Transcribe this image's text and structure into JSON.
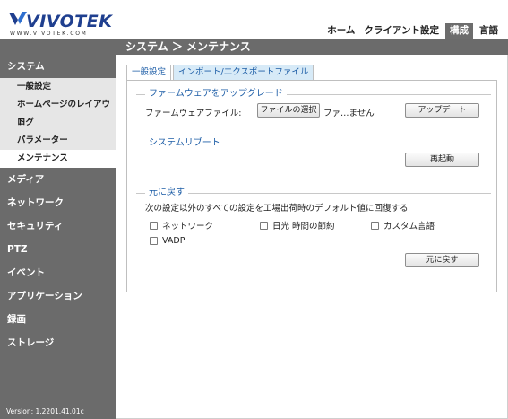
{
  "brand": {
    "name": "VIVOTEK",
    "url": "WWW.VIVOTEK.COM"
  },
  "topnav": [
    {
      "label": "ホーム",
      "active": false
    },
    {
      "label": "クライアント設定",
      "active": false
    },
    {
      "label": "構成",
      "active": true
    },
    {
      "label": "言語",
      "active": false
    }
  ],
  "page_title": "システム ＞ メンテナンス",
  "sidebar": {
    "system": {
      "label": "システム",
      "items": [
        {
          "label": "一般設定",
          "active": false
        },
        {
          "label": "ホームページのレイアウト",
          "active": false
        },
        {
          "label": "ログ",
          "active": false
        },
        {
          "label": "パラメーター",
          "active": false
        },
        {
          "label": "メンテナンス",
          "active": true
        }
      ]
    },
    "sections": [
      {
        "label": "メディア"
      },
      {
        "label": "ネットワーク"
      },
      {
        "label": "セキュリティ"
      },
      {
        "label": "PTZ"
      },
      {
        "label": "イベント"
      },
      {
        "label": "アプリケーション"
      },
      {
        "label": "録画"
      },
      {
        "label": "ストレージ"
      }
    ],
    "version": "Version: 1.2201.41.01c"
  },
  "tabs": [
    {
      "label": "一般設定",
      "selected": false
    },
    {
      "label": "インポート/エクスポートファイル",
      "selected": true
    }
  ],
  "firmware": {
    "heading": "ファームウェアをアップグレード",
    "file_label": "ファームウェアファイル:",
    "choose_button": "ファイルの選択",
    "file_status": "ファ…ません",
    "upgrade_button": "アップデート"
  },
  "reboot": {
    "heading": "システムリブート",
    "button": "再起動"
  },
  "restore": {
    "heading": "元に戻す",
    "description": "次の設定以外のすべての設定を工場出荷時のデフォルト値に回復する",
    "options": [
      {
        "label": "ネットワーク",
        "checked": false
      },
      {
        "label": "日光 時間の節約",
        "checked": false
      },
      {
        "label": "カスタム言語",
        "checked": false
      },
      {
        "label": "VADP",
        "checked": false
      }
    ],
    "button": "元に戻す"
  },
  "colors": {
    "accent": "#1e5ea7",
    "sidebar": "#6b6b6b",
    "logo": "#1f3f8f"
  }
}
